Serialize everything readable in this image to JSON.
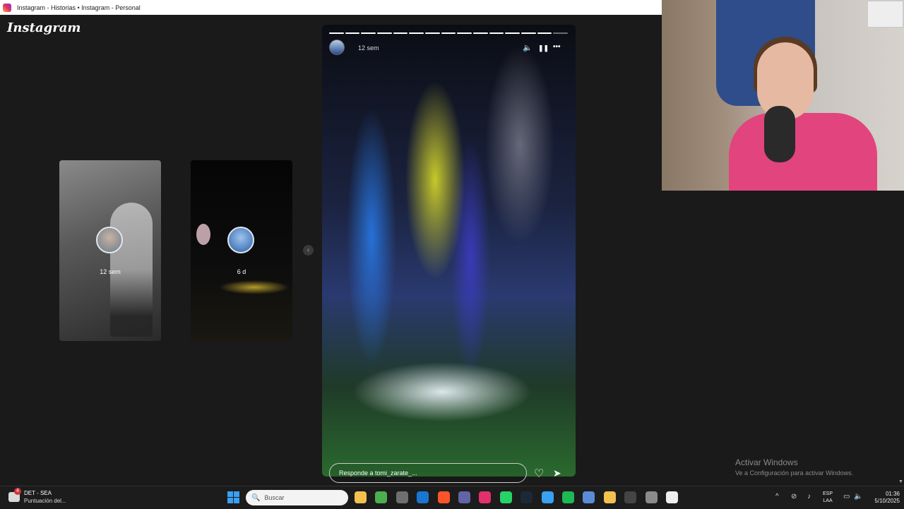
{
  "window": {
    "title": "Instagram - Historias • Instagram - Personal"
  },
  "instagram": {
    "logo": "Instagram"
  },
  "previews": [
    {
      "time": "12 sem"
    },
    {
      "time": "6 d"
    }
  ],
  "nav": {
    "prev_icon": "chevron-left-icon",
    "prev_glyph": "‹"
  },
  "story": {
    "time": "12 sem",
    "progress_segments": 15,
    "progress_current": 14,
    "volume_glyph": "🔈",
    "pause_glyph": "❚❚",
    "more_glyph": "•••",
    "reply_placeholder": "Responde a tomi_zarate_...",
    "heart_glyph": "♡",
    "send_glyph": "➤"
  },
  "watermark": {
    "line1": "Activar Windows",
    "line2": "Ve a Configuración para activar Windows."
  },
  "taskbar": {
    "weather_badge": "4",
    "weather_line1": "DET - SEA",
    "weather_line2": "Puntuación del...",
    "search_icon": "🔍",
    "search_placeholder": "Buscar",
    "apps": [
      {
        "name": "file-explorer-icon",
        "color": "#f2c14e"
      },
      {
        "name": "chrome-icon",
        "color": "#4caf50"
      },
      {
        "name": "store-icon",
        "color": "#6f6f6f"
      },
      {
        "name": "outlook-icon",
        "color": "#1976d2"
      },
      {
        "name": "brave-icon",
        "color": "#fb542b"
      },
      {
        "name": "teams-icon",
        "color": "#6264a7"
      },
      {
        "name": "instagram-icon",
        "color": "#e1306c"
      },
      {
        "name": "whatsapp-icon",
        "color": "#25d366"
      },
      {
        "name": "steam-icon",
        "color": "#1b2838"
      },
      {
        "name": "photo-icon",
        "color": "#3aa0f3"
      },
      {
        "name": "spotify-icon",
        "color": "#1db954"
      },
      {
        "name": "copilot-icon",
        "color": "#5a8bd6"
      },
      {
        "name": "app-icon",
        "color": "#f2c14e"
      },
      {
        "name": "chatgpt-icon",
        "color": "#444"
      },
      {
        "name": "settings-icon",
        "color": "#8a8a8a"
      },
      {
        "name": "capcut-icon",
        "color": "#eeeeee"
      }
    ],
    "tray": {
      "chevron": "^",
      "lang_line1": "ESP",
      "lang_line2": "LAA",
      "time": "01:36",
      "date": "5/10/2025"
    }
  }
}
